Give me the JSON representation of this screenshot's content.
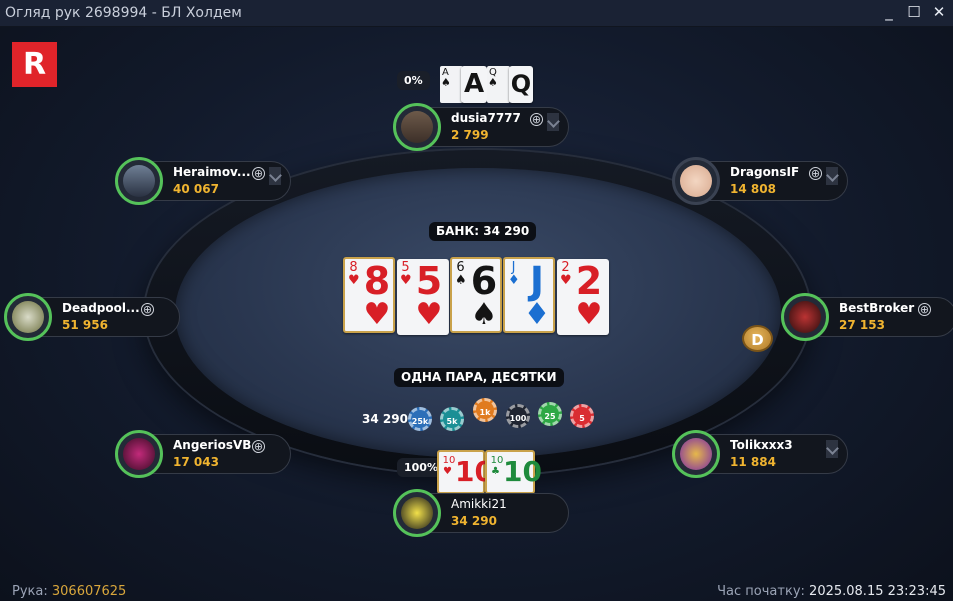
{
  "window": {
    "title": "Огляд рук 2698994 - БЛ Холдем",
    "minimize": "_",
    "maximize": "☐",
    "close": "✕"
  },
  "logo": "R",
  "pot": {
    "label": "БАНК: 34 290"
  },
  "hand_result": "ОДНА ПАРА, ДЕСЯТКИ",
  "bet": {
    "amount": "34 290",
    "chips": [
      "25k",
      "5k",
      "1k",
      "100",
      "25",
      "5"
    ]
  },
  "board": [
    {
      "rank": "8",
      "suit": "♥",
      "color": "#d81f26"
    },
    {
      "rank": "5",
      "suit": "♥",
      "color": "#d81f26"
    },
    {
      "rank": "6",
      "suit": "♠",
      "color": "#141414"
    },
    {
      "rank": "J",
      "suit": "♦",
      "color": "#1b6fd1"
    },
    {
      "rank": "2",
      "suit": "♥",
      "color": "#d81f26"
    }
  ],
  "players": {
    "top": {
      "name": "dusia7777",
      "stack": "2 799",
      "equity": "0%",
      "cards": [
        {
          "rank": "A",
          "suit": "♠"
        },
        {
          "rank": "A",
          "suit": "♠"
        },
        {
          "rank": "Q",
          "suit": "♠"
        }
      ]
    },
    "top_left": {
      "name": "Heraimov...",
      "stack": "40 067"
    },
    "top_right": {
      "name": "DragonsIF",
      "stack": "14 808"
    },
    "left": {
      "name": "Deadpool...",
      "stack": "51 956"
    },
    "right": {
      "name": "BestBroker",
      "stack": "27 153"
    },
    "bottom_left": {
      "name": "AngeriosVB",
      "stack": "17 043"
    },
    "bottom_right": {
      "name": "Tolikxxx3",
      "stack": "11 884"
    },
    "hero": {
      "name": "Amikki21",
      "stack": "34 290",
      "equity": "100%",
      "cards": [
        {
          "rank": "10",
          "suit": "♥",
          "color": "#d81f26"
        },
        {
          "rank": "10",
          "suit": "♣",
          "color": "#1e8a3c"
        }
      ]
    }
  },
  "dealer_button": "D",
  "plus_icon": "⊕",
  "footer": {
    "hand_label": "Рука:",
    "hand_id": "306607625",
    "start_label": "Час початку:",
    "start_time": "2025.08.15 23:23:45"
  }
}
